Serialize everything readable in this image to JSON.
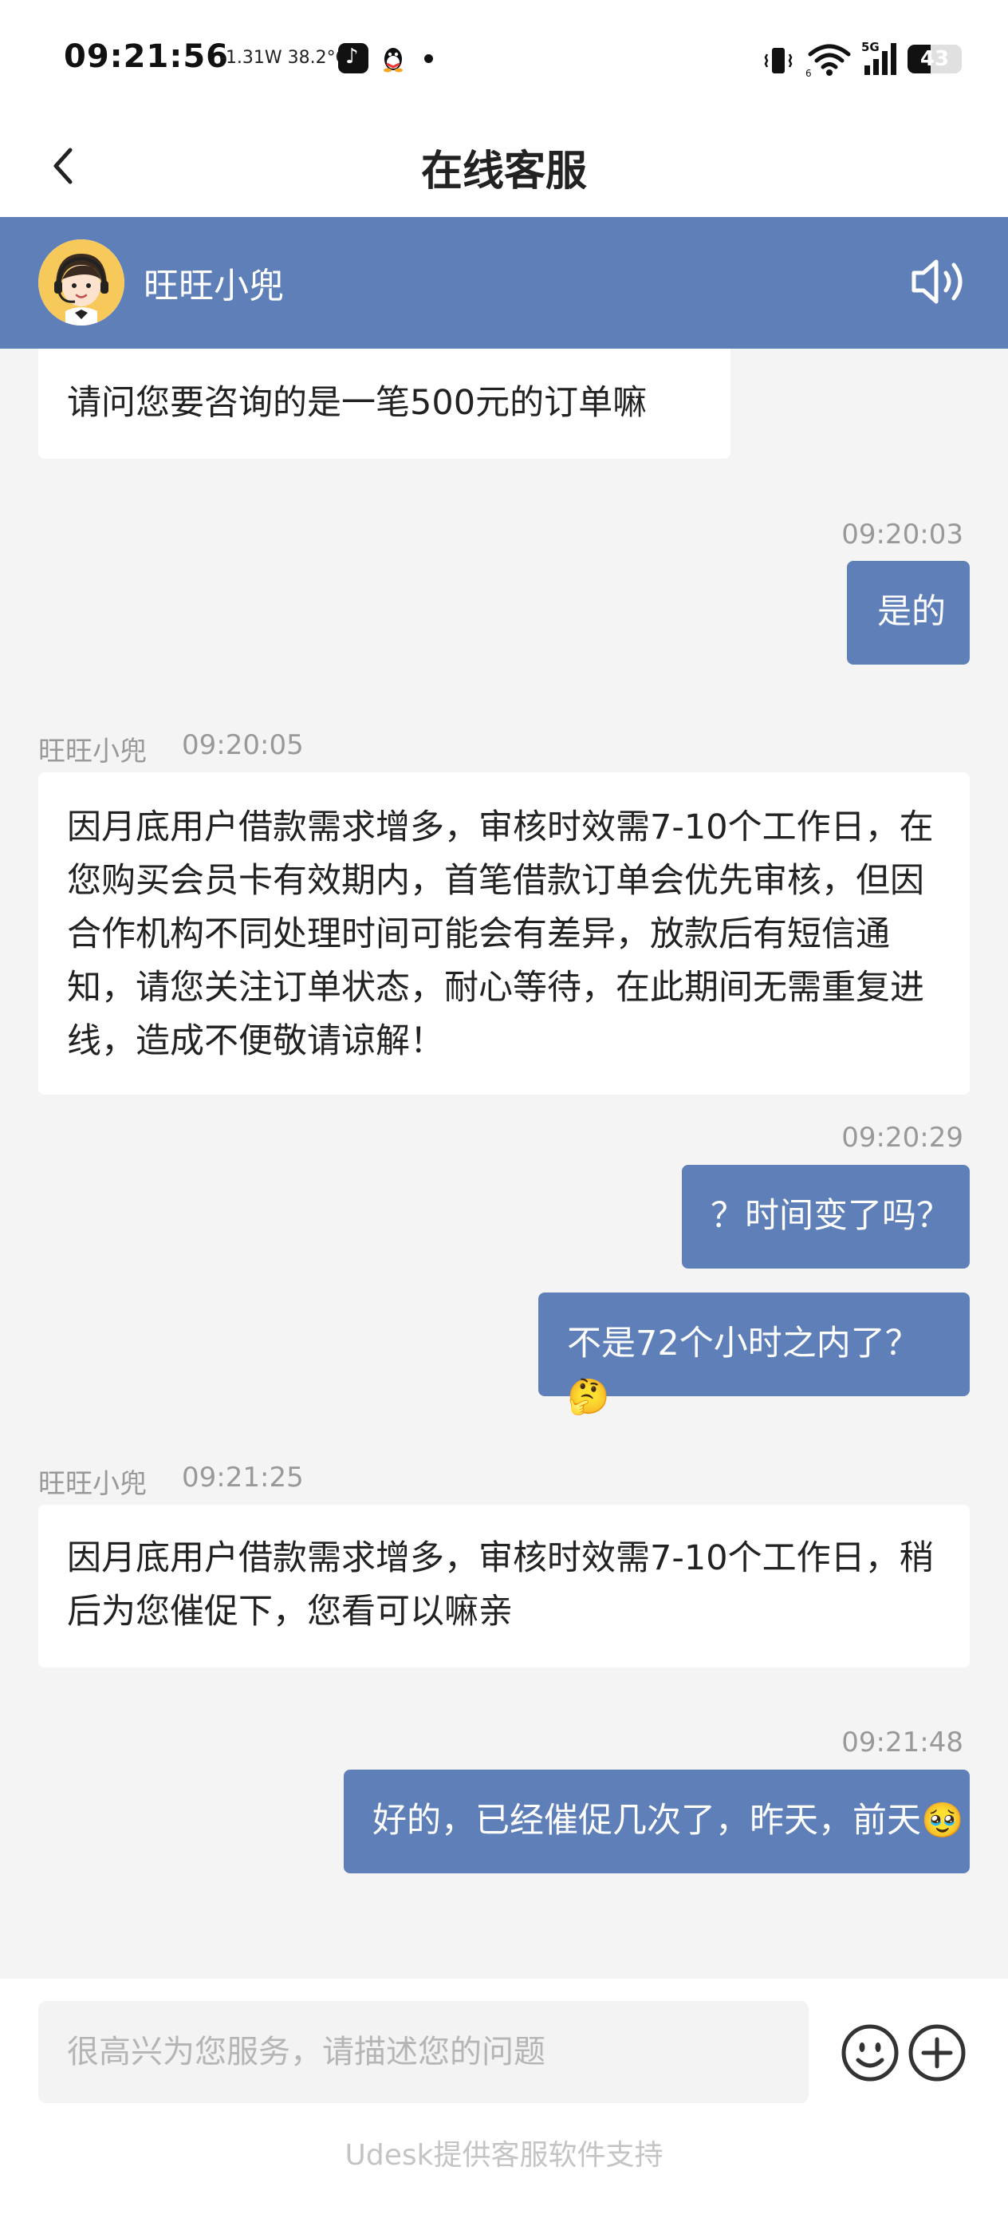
{
  "status_bar": {
    "time": "09:21:56",
    "info": "-1.31W 38.2°C",
    "network": "5G",
    "battery": "43",
    "battery_level_percent": 43
  },
  "header": {
    "title": "在线客服"
  },
  "agent": {
    "name": "旺旺小兜"
  },
  "messages": [
    {
      "from": "agent",
      "text": "请问您要咨询的是一笔500元的订单嘛"
    },
    {
      "from": "user",
      "time": "09:20:03",
      "text": "是的"
    },
    {
      "from": "agent",
      "sender": "旺旺小兜",
      "time": "09:20:05",
      "text": "因月底用户借款需求增多，审核时效需7-10个工作日，在您购买会员卡有效期内，首笔借款订单会优先审核，但因合作机构不同处理时间可能会有差异，放款后有短信通知，请您关注订单状态，耐心等待，在此期间无需重复进线，造成不便敬请谅解！"
    },
    {
      "from": "user",
      "time": "09:20:29",
      "text": "？时间变了吗？"
    },
    {
      "from": "user",
      "text": "不是72个小时之内了？ 🤔"
    },
    {
      "from": "agent",
      "sender": "旺旺小兜",
      "time": "09:21:25",
      "text": "因月底用户借款需求增多，审核时效需7-10个工作日，稍后为您催促下，您看可以嘛亲"
    },
    {
      "from": "user",
      "time": "09:21:48",
      "text": "好的，已经催促几次了，昨天，前天🥹"
    }
  ],
  "input": {
    "placeholder": "很高兴为您服务，请描述您的问题",
    "value": ""
  },
  "footer": {
    "text": "Udesk提供客服软件支持"
  },
  "colors": {
    "brand": "#5f7fb8",
    "page_bg": "#f4f4f4",
    "bubble_agent": "#ffffff",
    "timestamp": "#999999"
  },
  "icons": [
    "back-icon",
    "speaker-icon",
    "emoji-icon",
    "plus-icon",
    "wifi-icon",
    "signal-icon",
    "vibrate-icon",
    "battery-icon"
  ]
}
